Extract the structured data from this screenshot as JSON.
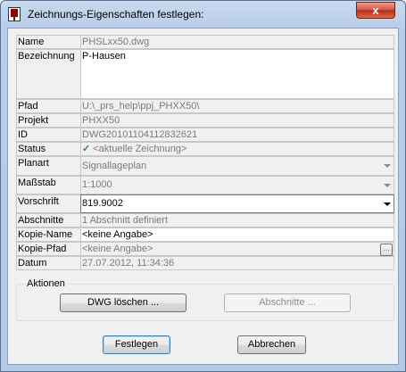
{
  "window": {
    "title": "Zeichnungs-Eigenschaften festlegen:",
    "close_glyph": "x"
  },
  "fields": {
    "name": {
      "label": "Name",
      "value": "PHSLxx50.dwg"
    },
    "bezeichnung": {
      "label": "Bezeichnung",
      "value": "P-Hausen"
    },
    "pfad": {
      "label": "Pfad",
      "value": "U:\\_prs_help\\ppj_PHXX50\\"
    },
    "projekt": {
      "label": "Projekt",
      "value": "PHXX50"
    },
    "id": {
      "label": "ID",
      "value": "DWG20101104112832621"
    },
    "status": {
      "label": "Status",
      "check": "✓",
      "value": "<aktuelle Zeichnung>"
    },
    "planart": {
      "label": "Planart",
      "value": "Signallageplan"
    },
    "massstab": {
      "label": "Maßstab",
      "value": "1:1000"
    },
    "vorschrift": {
      "label": "Vorschrift",
      "value": "819.9002"
    },
    "abschnitte": {
      "label": "Abschnitte",
      "value": "1 Abschnitt definiert"
    },
    "kopie_name": {
      "label": "Kopie-Name",
      "value": "<keine Angabe>"
    },
    "kopie_pfad": {
      "label": "Kopie-Pfad",
      "value": "<keine Angabe>",
      "button": "..."
    },
    "datum": {
      "label": "Datum",
      "value": "27.07.2012, 11:34:36"
    }
  },
  "aktionen": {
    "label": "Aktionen",
    "dwg_loeschen": "DWG löschen ...",
    "abschnitte": "Abschnitte ..."
  },
  "footer": {
    "festlegen": "Festlegen",
    "abbrechen": "Abbrechen"
  }
}
